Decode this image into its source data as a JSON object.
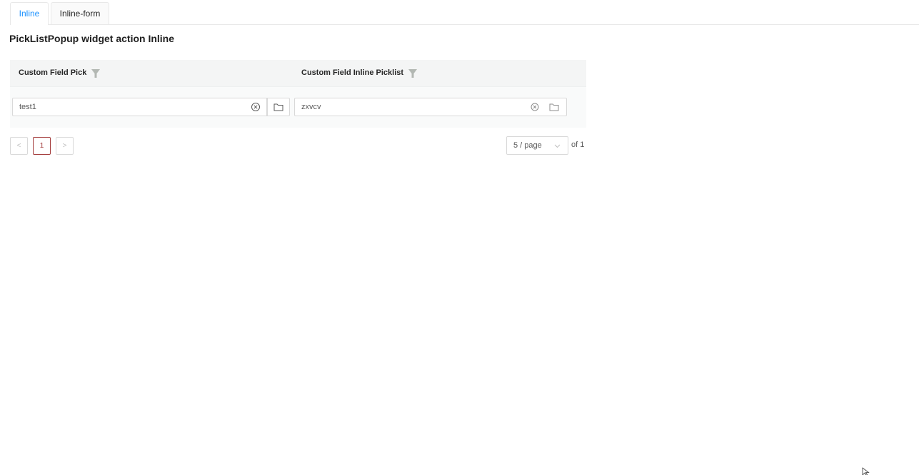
{
  "tabs": [
    {
      "label": "Inline",
      "active": true
    },
    {
      "label": "Inline-form",
      "active": false
    }
  ],
  "page_title": "PickListPopup widget action Inline",
  "table": {
    "columns": [
      {
        "label": "Custom Field Pick",
        "icon": "filter-icon"
      },
      {
        "label": "Custom Field Inline Picklist",
        "icon": "filter-icon"
      }
    ],
    "rows": [
      {
        "custom_field_pick": "test1",
        "custom_field_inline_picklist": "zxvcv"
      }
    ]
  },
  "pagination": {
    "prev": "<",
    "pages": [
      "1"
    ],
    "current_page": "1",
    "next": ">",
    "page_size": "5 / page",
    "total_prefix": "of",
    "total_pages": "1",
    "total_text": "of 1"
  },
  "colors": {
    "accent_tab": "#1890ff",
    "current_page_border": "#a33a3a",
    "header_bg": "#f4f5f5"
  }
}
